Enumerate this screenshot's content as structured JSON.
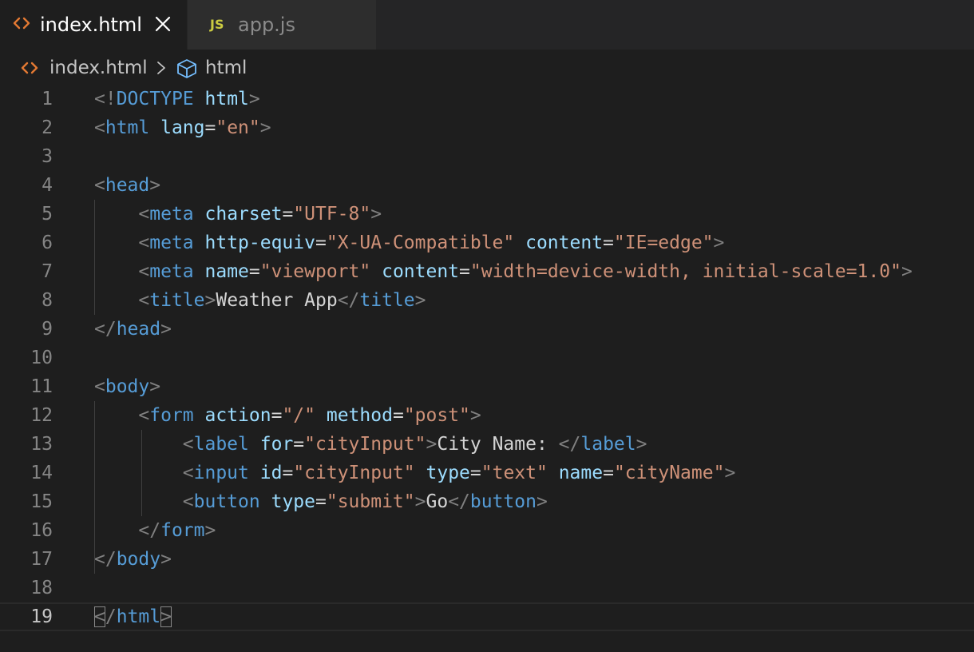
{
  "tabs": [
    {
      "label": "index.html",
      "icon": "html-file-icon",
      "active": true
    },
    {
      "label": "app.js",
      "icon": "js-file-icon",
      "badge": "JS",
      "active": false
    }
  ],
  "breadcrumb": {
    "file": "index.html",
    "node": "html"
  },
  "colors": {
    "background": "#1e1e1e",
    "tag": "#569cd6",
    "attribute": "#9cdcfe",
    "string": "#ce9178",
    "punctuation": "#808080",
    "text": "#d4d4d4",
    "html_icon": "#e37933",
    "js_icon": "#cbcb41"
  },
  "editor": {
    "current_line": 19,
    "lines": [
      {
        "n": "1",
        "tokens": [
          [
            "p",
            "<!"
          ],
          [
            "t",
            "DOCTYPE"
          ],
          [
            "x",
            " "
          ],
          [
            "a",
            "html"
          ],
          [
            "p",
            ">"
          ]
        ]
      },
      {
        "n": "2",
        "tokens": [
          [
            "p",
            "<"
          ],
          [
            "t",
            "html"
          ],
          [
            "x",
            " "
          ],
          [
            "a",
            "lang"
          ],
          [
            "x",
            "="
          ],
          [
            "s",
            "\"en\""
          ],
          [
            "p",
            ">"
          ]
        ]
      },
      {
        "n": "3",
        "tokens": []
      },
      {
        "n": "4",
        "tokens": [
          [
            "p",
            "<"
          ],
          [
            "t",
            "head"
          ],
          [
            "p",
            ">"
          ]
        ]
      },
      {
        "n": "5",
        "tokens": [
          [
            "x",
            "    "
          ],
          [
            "p",
            "<"
          ],
          [
            "t",
            "meta"
          ],
          [
            "x",
            " "
          ],
          [
            "a",
            "charset"
          ],
          [
            "x",
            "="
          ],
          [
            "s",
            "\"UTF-8\""
          ],
          [
            "p",
            ">"
          ]
        ]
      },
      {
        "n": "6",
        "tokens": [
          [
            "x",
            "    "
          ],
          [
            "p",
            "<"
          ],
          [
            "t",
            "meta"
          ],
          [
            "x",
            " "
          ],
          [
            "a",
            "http-equiv"
          ],
          [
            "x",
            "="
          ],
          [
            "s",
            "\"X-UA-Compatible\""
          ],
          [
            "x",
            " "
          ],
          [
            "a",
            "content"
          ],
          [
            "x",
            "="
          ],
          [
            "s",
            "\"IE=edge\""
          ],
          [
            "p",
            ">"
          ]
        ]
      },
      {
        "n": "7",
        "tokens": [
          [
            "x",
            "    "
          ],
          [
            "p",
            "<"
          ],
          [
            "t",
            "meta"
          ],
          [
            "x",
            " "
          ],
          [
            "a",
            "name"
          ],
          [
            "x",
            "="
          ],
          [
            "s",
            "\"viewport\""
          ],
          [
            "x",
            " "
          ],
          [
            "a",
            "content"
          ],
          [
            "x",
            "="
          ],
          [
            "s",
            "\"width=device-width, initial-scale=1.0\""
          ],
          [
            "p",
            ">"
          ]
        ]
      },
      {
        "n": "8",
        "tokens": [
          [
            "x",
            "    "
          ],
          [
            "p",
            "<"
          ],
          [
            "t",
            "title"
          ],
          [
            "p",
            ">"
          ],
          [
            "x",
            "Weather App"
          ],
          [
            "p",
            "</"
          ],
          [
            "t",
            "title"
          ],
          [
            "p",
            ">"
          ]
        ]
      },
      {
        "n": "9",
        "tokens": [
          [
            "p",
            "</"
          ],
          [
            "t",
            "head"
          ],
          [
            "p",
            ">"
          ]
        ]
      },
      {
        "n": "10",
        "tokens": []
      },
      {
        "n": "11",
        "tokens": [
          [
            "p",
            "<"
          ],
          [
            "t",
            "body"
          ],
          [
            "p",
            ">"
          ]
        ]
      },
      {
        "n": "12",
        "tokens": [
          [
            "x",
            "    "
          ],
          [
            "p",
            "<"
          ],
          [
            "t",
            "form"
          ],
          [
            "x",
            " "
          ],
          [
            "a",
            "action"
          ],
          [
            "x",
            "="
          ],
          [
            "s",
            "\"/\""
          ],
          [
            "x",
            " "
          ],
          [
            "a",
            "method"
          ],
          [
            "x",
            "="
          ],
          [
            "s",
            "\"post\""
          ],
          [
            "p",
            ">"
          ]
        ]
      },
      {
        "n": "13",
        "tokens": [
          [
            "x",
            "        "
          ],
          [
            "p",
            "<"
          ],
          [
            "t",
            "label"
          ],
          [
            "x",
            " "
          ],
          [
            "a",
            "for"
          ],
          [
            "x",
            "="
          ],
          [
            "s",
            "\"cityInput\""
          ],
          [
            "p",
            ">"
          ],
          [
            "x",
            "City Name: "
          ],
          [
            "p",
            "</"
          ],
          [
            "t",
            "label"
          ],
          [
            "p",
            ">"
          ]
        ]
      },
      {
        "n": "14",
        "tokens": [
          [
            "x",
            "        "
          ],
          [
            "p",
            "<"
          ],
          [
            "t",
            "input"
          ],
          [
            "x",
            " "
          ],
          [
            "a",
            "id"
          ],
          [
            "x",
            "="
          ],
          [
            "s",
            "\"cityInput\""
          ],
          [
            "x",
            " "
          ],
          [
            "a",
            "type"
          ],
          [
            "x",
            "="
          ],
          [
            "s",
            "\"text\""
          ],
          [
            "x",
            " "
          ],
          [
            "a",
            "name"
          ],
          [
            "x",
            "="
          ],
          [
            "s",
            "\"cityName\""
          ],
          [
            "p",
            ">"
          ]
        ]
      },
      {
        "n": "15",
        "tokens": [
          [
            "x",
            "        "
          ],
          [
            "p",
            "<"
          ],
          [
            "t",
            "button"
          ],
          [
            "x",
            " "
          ],
          [
            "a",
            "type"
          ],
          [
            "x",
            "="
          ],
          [
            "s",
            "\"submit\""
          ],
          [
            "p",
            ">"
          ],
          [
            "x",
            "Go"
          ],
          [
            "p",
            "</"
          ],
          [
            "t",
            "button"
          ],
          [
            "p",
            ">"
          ]
        ]
      },
      {
        "n": "16",
        "tokens": [
          [
            "x",
            "    "
          ],
          [
            "p",
            "</"
          ],
          [
            "t",
            "form"
          ],
          [
            "p",
            ">"
          ]
        ]
      },
      {
        "n": "17",
        "tokens": [
          [
            "p",
            "</"
          ],
          [
            "t",
            "body"
          ],
          [
            "p",
            ">"
          ]
        ]
      },
      {
        "n": "18",
        "tokens": []
      },
      {
        "n": "19",
        "tokens": [
          [
            "p",
            "<"
          ],
          [
            "p",
            "/"
          ],
          [
            "t",
            "html"
          ],
          [
            "p",
            ">"
          ]
        ]
      }
    ]
  }
}
